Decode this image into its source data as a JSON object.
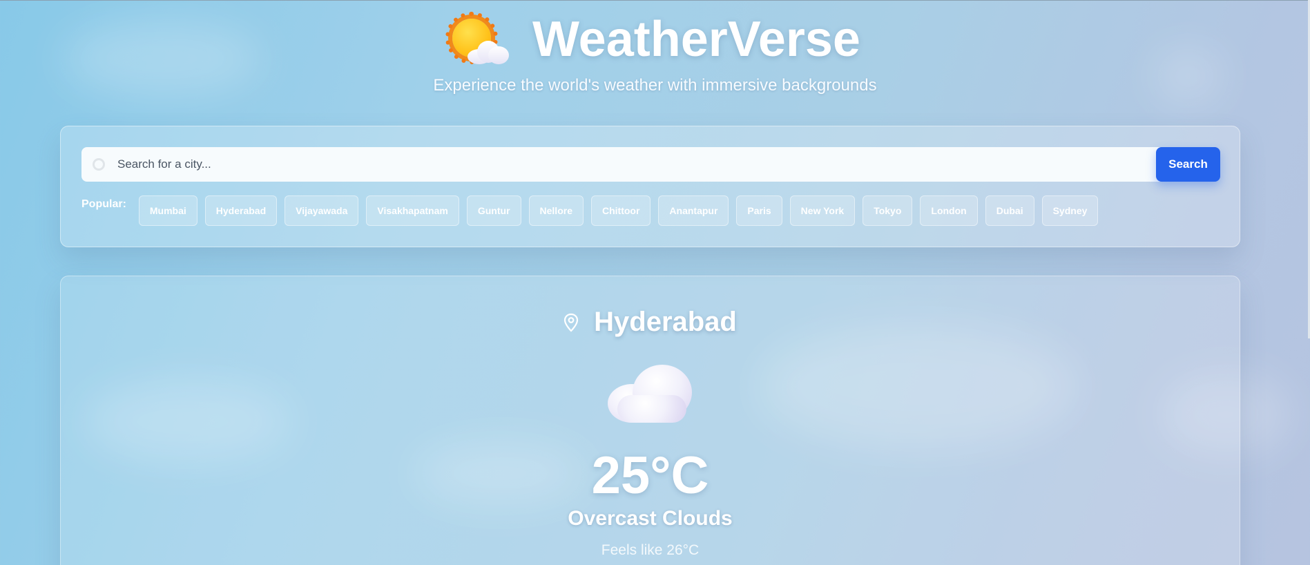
{
  "app": {
    "title": "WeatherVerse",
    "subtitle": "Experience the world's weather with immersive backgrounds",
    "logo_icon": "sun-behind-cloud-icon"
  },
  "search": {
    "placeholder": "Search for a city...",
    "value": "",
    "button_label": "Search",
    "accent_color": "#2563eb"
  },
  "popular": {
    "label": "Popular:",
    "cities": [
      "Mumbai",
      "Hyderabad",
      "Vijayawada",
      "Visakhapatnam",
      "Guntur",
      "Nellore",
      "Chittoor",
      "Anantapur",
      "Paris",
      "New York",
      "Tokyo",
      "London",
      "Dubai",
      "Sydney"
    ]
  },
  "weather": {
    "city": "Hyderabad",
    "location_icon": "map-pin-icon",
    "condition_icon": "cloud-icon",
    "temperature": "25°C",
    "condition": "Overcast Clouds",
    "feels_like": "Feels like 26°C"
  }
}
